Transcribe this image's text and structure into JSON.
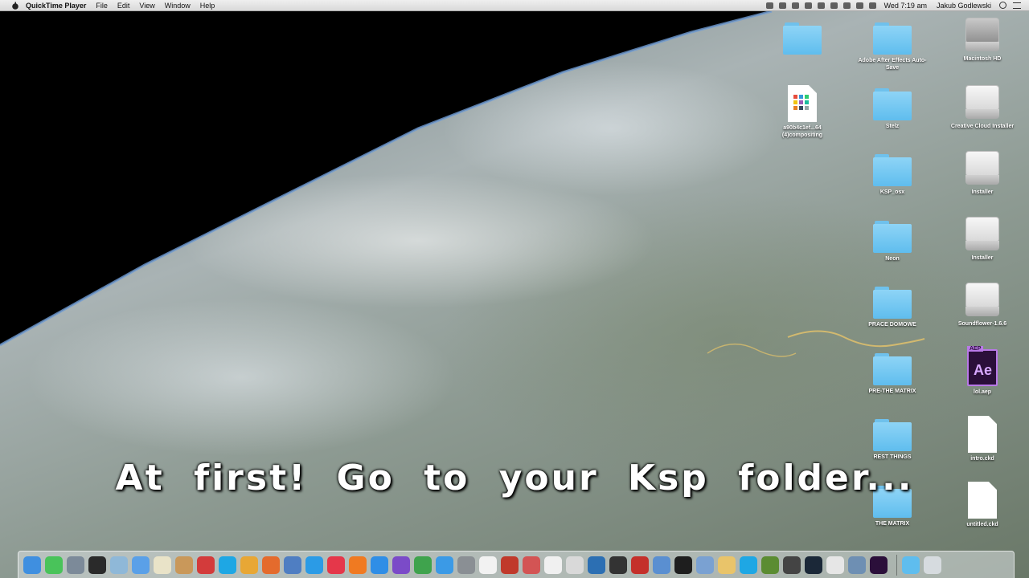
{
  "menubar": {
    "app_name": "QuickTime Player",
    "menus": [
      "File",
      "Edit",
      "View",
      "Window",
      "Help"
    ],
    "clock": "Wed 7:19 am",
    "user": "Jakub Godlewski"
  },
  "desktop_icons": [
    {
      "label": "",
      "kind": "folder",
      "name": "desktop-folder-untitled"
    },
    {
      "label": "Adobe After Effects Auto-Save",
      "kind": "folder",
      "name": "desktop-folder-ae-autosave"
    },
    {
      "label": "Macintosh HD",
      "kind": "hdd",
      "name": "desktop-drive-macintosh-hd"
    },
    {
      "label": "a90b4c1ef...64 (4)compositing",
      "kind": "doc-grid",
      "name": "desktop-file-compositing"
    },
    {
      "label": "Stelz",
      "kind": "folder",
      "name": "desktop-folder-stelz"
    },
    {
      "label": "Creative Cloud Installer",
      "kind": "drive",
      "name": "desktop-drive-creative-cloud"
    },
    {
      "label": "KSP_osx",
      "kind": "folder",
      "name": "desktop-folder-ksp-osx"
    },
    {
      "label": "Installer",
      "kind": "drive",
      "name": "desktop-drive-installer-1"
    },
    {
      "label": "Neon",
      "kind": "folder",
      "name": "desktop-folder-neon"
    },
    {
      "label": "Installer",
      "kind": "drive",
      "name": "desktop-drive-installer-2"
    },
    {
      "label": "PRACE DOMOWE",
      "kind": "folder",
      "name": "desktop-folder-prace-domowe"
    },
    {
      "label": "Soundflower-1.6.6",
      "kind": "drive",
      "name": "desktop-drive-soundflower"
    },
    {
      "label": "PRE-THE MATRIX",
      "kind": "folder",
      "name": "desktop-folder-pre-the-matrix"
    },
    {
      "label": "lol.aep",
      "kind": "ae",
      "name": "desktop-file-lol-aep"
    },
    {
      "label": "REST THINGS",
      "kind": "folder",
      "name": "desktop-folder-rest-things"
    },
    {
      "label": "intro.ckd",
      "kind": "doc",
      "name": "desktop-file-intro-ckd"
    },
    {
      "label": "THE MATRIX",
      "kind": "folder",
      "name": "desktop-folder-the-matrix"
    },
    {
      "label": "untitled.ckd",
      "kind": "doc",
      "name": "desktop-file-untitled-ckd"
    }
  ],
  "ae_badge": "AEP",
  "ae_glyph": "Ae",
  "caption": "At first! Go to your Ksp folder...",
  "dock_apps": [
    {
      "name": "finder-icon",
      "color": "#3f8fe0"
    },
    {
      "name": "messages-icon",
      "color": "#49c35a"
    },
    {
      "name": "photo-app-icon",
      "color": "#7c8a99"
    },
    {
      "name": "launchpad-icon",
      "color": "#2a2a2a"
    },
    {
      "name": "preview-icon",
      "color": "#8fb8d8"
    },
    {
      "name": "charts-icon",
      "color": "#5aa0e8"
    },
    {
      "name": "textedit-icon",
      "color": "#e9e3c8"
    },
    {
      "name": "cookie-icon",
      "color": "#c9985a"
    },
    {
      "name": "lipstick-icon",
      "color": "#d33b3b"
    },
    {
      "name": "skype-icon",
      "color": "#1ea7e4"
    },
    {
      "name": "colors-icon",
      "color": "#e8a735"
    },
    {
      "name": "tools-icon",
      "color": "#e46b2d"
    },
    {
      "name": "xcode-icon",
      "color": "#4f7ec2"
    },
    {
      "name": "safari-icon",
      "color": "#2b9be6"
    },
    {
      "name": "itunes-icon",
      "color": "#e5374a"
    },
    {
      "name": "ibooks-icon",
      "color": "#f07a21"
    },
    {
      "name": "app-store-icon",
      "color": "#2f8ee6"
    },
    {
      "name": "imovie-icon",
      "color": "#7b4bc8"
    },
    {
      "name": "chrome-icon",
      "color": "#3fa34d"
    },
    {
      "name": "safari-compass-icon",
      "color": "#3b9ae6"
    },
    {
      "name": "system-preferences-icon",
      "color": "#8a8f94"
    },
    {
      "name": "calendar-icon",
      "color": "#f2f2f2"
    },
    {
      "name": "photo-booth-icon",
      "color": "#c0392b"
    },
    {
      "name": "activity-icon",
      "color": "#d35454"
    },
    {
      "name": "pdf-icon",
      "color": "#f0f0f0"
    },
    {
      "name": "speech-icon",
      "color": "#d9d9d9"
    },
    {
      "name": "quicktime-icon",
      "color": "#2c6fb3"
    },
    {
      "name": "unity-icon",
      "color": "#333333"
    },
    {
      "name": "c-app-icon",
      "color": "#c4302b"
    },
    {
      "name": "stickies-icon",
      "color": "#5a8fd1"
    },
    {
      "name": "terminal-icon",
      "color": "#1e1e1e"
    },
    {
      "name": "grapher-icon",
      "color": "#7aa1d2"
    },
    {
      "name": "folder-app-icon",
      "color": "#e9c46a"
    },
    {
      "name": "skype-notify-icon",
      "color": "#1ea7e4"
    },
    {
      "name": "minecraft-icon",
      "color": "#5b8c32"
    },
    {
      "name": "sc-app-icon",
      "color": "#444444"
    },
    {
      "name": "steam-icon",
      "color": "#1b2838"
    },
    {
      "name": "notes-icon",
      "color": "#e6e6e6"
    },
    {
      "name": "magnifier-icon",
      "color": "#6e8fb3"
    },
    {
      "name": "after-effects-icon",
      "color": "#2b0f3a"
    }
  ],
  "dock_right": [
    {
      "name": "downloads-folder-icon",
      "color": "#5fbdee"
    },
    {
      "name": "trash-icon",
      "color": "#d6dbdf"
    }
  ]
}
